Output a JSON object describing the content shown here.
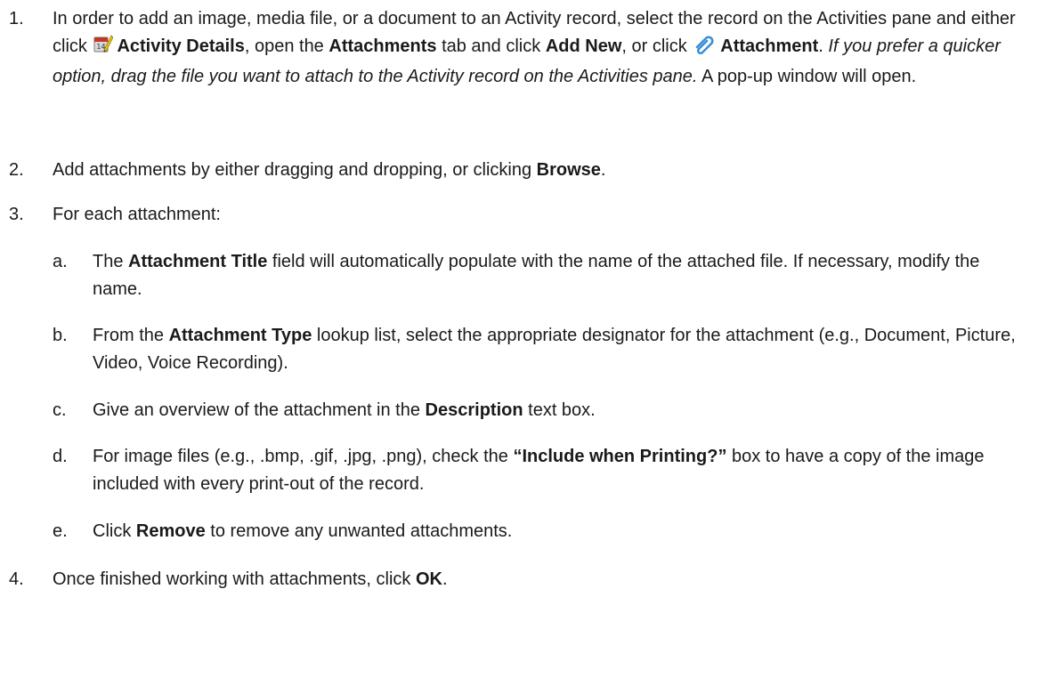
{
  "steps": [
    {
      "num": "1.",
      "parts": {
        "t1": "In order to add an image, media file, or a document to an Activity record, select the record on the Activities pane and either click ",
        "activity_details": "Activity Details",
        "t2": ", open the ",
        "attachments_tab": "Attachments",
        "t3": " tab and click ",
        "add_new": "Add New",
        "t4": ", or click ",
        "attachment": "Attachment",
        "t5": ". ",
        "italic": "If you prefer a quicker option, drag the file you want to attach to the Activity record on the Activities pane.",
        "t6": " A pop-up window will open."
      }
    },
    {
      "num": "2.",
      "parts": {
        "t1": "Add attachments by either dragging and dropping, or clicking ",
        "browse": "Browse",
        "t2": "."
      }
    },
    {
      "num": "3.",
      "parts": {
        "t1": "For each attachment:"
      }
    },
    {
      "num": "4.",
      "parts": {
        "t1": "Once finished working with attachments, click ",
        "ok": "OK",
        "t2": "."
      }
    }
  ],
  "substeps": [
    {
      "letter": "a.",
      "t1": "The ",
      "b1": "Attachment Title",
      "t2": " field will automatically populate with the name of the attached file. If necessary, modify the name."
    },
    {
      "letter": "b.",
      "t1": "From the ",
      "b1": "Attachment Type",
      "t2": " lookup list, select the appropriate designator for the attachment (e.g., Document, Picture, Video, Voice Recording)."
    },
    {
      "letter": "c.",
      "t1": "Give an overview of the attachment in the ",
      "b1": "Description",
      "t2": " text box."
    },
    {
      "letter": "d.",
      "t1": "For image files (e.g., .bmp, .gif, .jpg, .png), check the ",
      "b1": "“Include when Printing?”",
      "t2": " box to have a copy of the image included with every print-out of the record."
    },
    {
      "letter": "e.",
      "t1": "Click ",
      "b1": "Remove",
      "t2": " to remove any unwanted attachments."
    }
  ],
  "icons": {
    "activity_details": "activity-details-icon",
    "attachment": "paperclip-icon"
  }
}
